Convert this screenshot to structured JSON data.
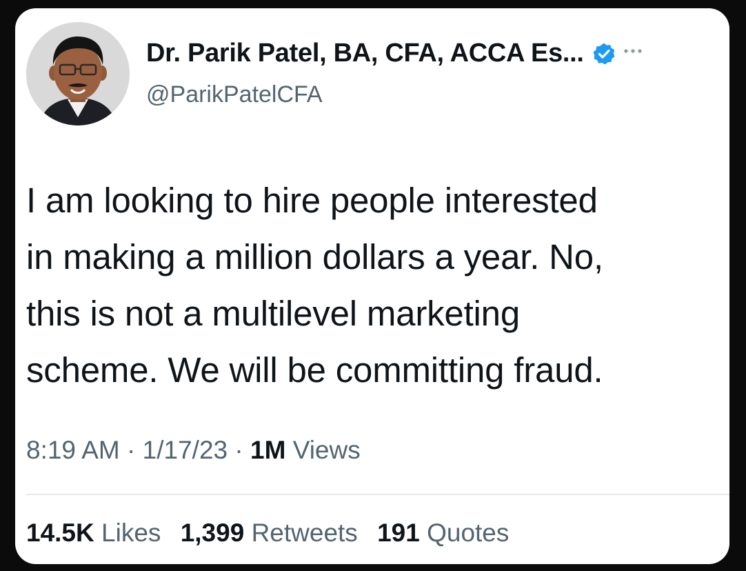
{
  "tweet": {
    "author": {
      "display_name": "Dr. Parik Patel, BA, CFA, ACCA Es...",
      "handle": "@ParikPatelCFA",
      "verified": true,
      "verified_color": "#1d9bf0"
    },
    "text": "I am looking to hire people interested\nin making a million dollars a year. No,\nthis is not a multilevel marketing\nscheme. We will be committing fraud.",
    "time": "8:19 AM",
    "separator": "·",
    "date": "1/17/23",
    "views_count": "1M",
    "views_label": "Views",
    "likes_count": "14.5K",
    "likes_label": "Likes",
    "retweets_count": "1,399",
    "retweets_label": "Retweets",
    "quotes_count": "191",
    "quotes_label": "Quotes"
  },
  "icons": {
    "verified": "verified-badge-icon",
    "more": "more-options-icon"
  }
}
